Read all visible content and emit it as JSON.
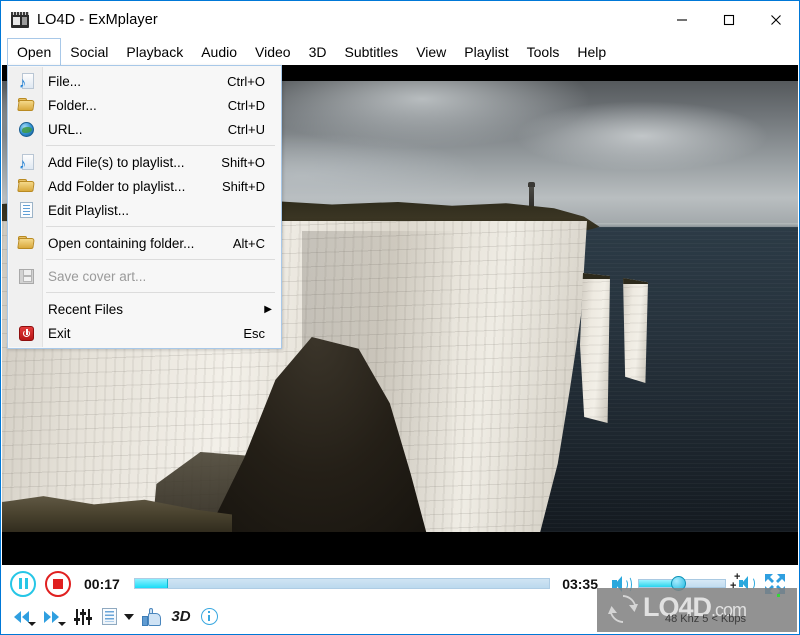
{
  "window": {
    "title": "LO4D - ExMplayer",
    "app_icon": "film-clapperboard-icon",
    "minimize_label": "–",
    "maximize_label": "☐",
    "close_label": "✕",
    "accent_color": "#0078d7"
  },
  "menubar": {
    "items": [
      {
        "label": "Open",
        "active": true
      },
      {
        "label": "Social",
        "active": false
      },
      {
        "label": "Playback",
        "active": false
      },
      {
        "label": "Audio",
        "active": false
      },
      {
        "label": "Video",
        "active": false
      },
      {
        "label": "3D",
        "active": false
      },
      {
        "label": "Subtitles",
        "active": false
      },
      {
        "label": "View",
        "active": false
      },
      {
        "label": "Playlist",
        "active": false
      },
      {
        "label": "Tools",
        "active": false
      },
      {
        "label": "Help",
        "active": false
      }
    ]
  },
  "open_menu": {
    "items": [
      {
        "label": "File...",
        "accel": "Ctrl+O",
        "icon": "music-note-icon",
        "disabled": false,
        "submenu": false
      },
      {
        "label": "Folder...",
        "accel": "Ctrl+D",
        "icon": "folder-icon",
        "disabled": false,
        "submenu": false
      },
      {
        "label": "URL..",
        "accel": "Ctrl+U",
        "icon": "globe-icon",
        "disabled": false,
        "submenu": false
      },
      {
        "label": "Add File(s) to playlist...",
        "accel": "Shift+O",
        "icon": "music-note-icon",
        "disabled": false,
        "submenu": false
      },
      {
        "label": "Add Folder to playlist...",
        "accel": "Shift+D",
        "icon": "folder-icon",
        "disabled": false,
        "submenu": false
      },
      {
        "label": "Edit Playlist...",
        "accel": "",
        "icon": "document-icon",
        "disabled": false,
        "submenu": false
      },
      {
        "label": "Open containing folder...",
        "accel": "Alt+C",
        "icon": "folder-icon",
        "disabled": false,
        "submenu": false
      },
      {
        "label": "Save cover art...",
        "accel": "",
        "icon": "save-disk-icon",
        "disabled": true,
        "submenu": false
      },
      {
        "label": "Recent Files",
        "accel": "",
        "icon": "",
        "disabled": false,
        "submenu": true
      },
      {
        "label": "Exit",
        "accel": "Esc",
        "icon": "power-exit-icon",
        "disabled": false,
        "submenu": false
      }
    ]
  },
  "player": {
    "pause_label": "Pause",
    "stop_label": "Stop",
    "current_time": "00:17",
    "total_time": "03:35",
    "seek_percent": 8,
    "volume_percent": 45,
    "status": "48 Khz 5 < Kbps",
    "fullscreen_label": "Fullscreen",
    "mute_label": "Mute",
    "volume_boost_label": "Volume boost"
  },
  "toolbar": {
    "rewind_label": "Rewind",
    "forward_label": "Fast forward",
    "equalizer_label": "Equalizer",
    "playlist_label": "Playlist panel",
    "playlist_caret_label": "More",
    "like_label": "Like",
    "three_d_label": "3D",
    "info_label": "Media info"
  },
  "watermark": {
    "brand": "LO4D",
    "domain": ".com",
    "logo": "refresh-circle-icon"
  }
}
